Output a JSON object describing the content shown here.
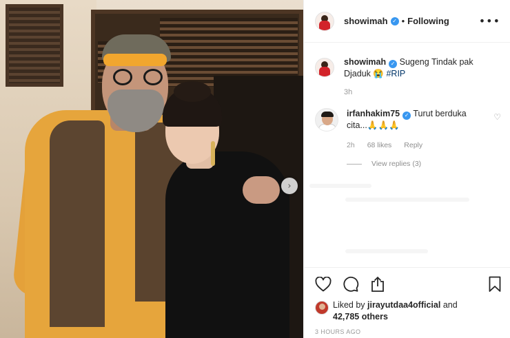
{
  "post": {
    "username": "showimah",
    "follow_status": "Following",
    "more_icon": "more-options-icon",
    "caption_text": "Sugeng Tindak pak Djaduk",
    "caption_emoji": "😭",
    "caption_hashtag": "#RIP",
    "caption_time": "3h",
    "next_icon": "chevron-right-icon"
  },
  "comments": [
    {
      "username": "irfanhakim75",
      "text": "Turut berduka cita...",
      "emoji": "🙏🙏🙏",
      "time": "2h",
      "likes": "68 likes",
      "reply_label": "Reply",
      "view_replies": "View replies (3)"
    }
  ],
  "actions": {
    "liked_by_prefix": "Liked by",
    "liked_by_user": "jirayutdaa4official",
    "liked_by_suffix": "and",
    "others": "42,785 others",
    "posted_ago": "3 HOURS AGO"
  },
  "colors": {
    "verified": "#3897f0",
    "hashtag": "#003569",
    "muted": "#8e8e8e"
  }
}
